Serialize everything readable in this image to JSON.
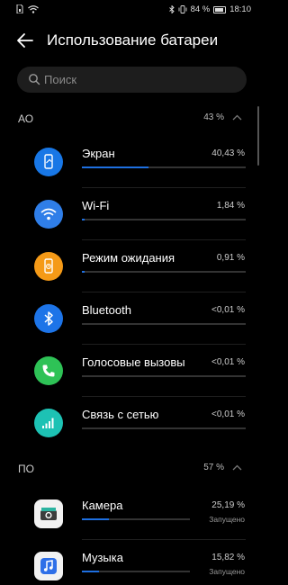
{
  "status_bar": {
    "battery_pct": "84 %",
    "time": "18:10"
  },
  "header": {
    "title": "Использование батареи"
  },
  "search": {
    "placeholder": "Поиск"
  },
  "sections": [
    {
      "name": "АО",
      "percent": "43 %"
    },
    {
      "name": "ПО",
      "percent": "57 %"
    }
  ],
  "hardware_items": [
    {
      "label": "Экран",
      "value": "40,43 %",
      "fill": 0.404,
      "color": "#1877e6",
      "icon": "screen-icon"
    },
    {
      "label": "Wi-Fi",
      "value": "1,84 %",
      "fill": 0.018,
      "color": "#2f7ee8",
      "icon": "wifi-icon"
    },
    {
      "label": "Режим ожидания",
      "value": "0,91 %",
      "fill": 0.009,
      "color": "#f59a17",
      "icon": "standby-icon"
    },
    {
      "label": "Bluetooth",
      "value": "<0,01 %",
      "fill": 0.0,
      "color": "#1d74e8",
      "icon": "bluetooth-icon"
    },
    {
      "label": "Голосовые вызовы",
      "value": "<0,01 %",
      "fill": 0.0,
      "color": "#2ec256",
      "icon": "phone-icon"
    },
    {
      "label": "Связь с сетью",
      "value": "<0,01 %",
      "fill": 0.0,
      "color": "#1dc2b4",
      "icon": "signal-icon"
    }
  ],
  "app_items": [
    {
      "label": "Камера",
      "value": "25,19 %",
      "status": "Запущено",
      "fill": 0.252,
      "icon": "camera-app-icon"
    },
    {
      "label": "Музыка",
      "value": "15,82 %",
      "status": "Запущено",
      "fill": 0.158,
      "icon": "music-app-icon"
    }
  ]
}
